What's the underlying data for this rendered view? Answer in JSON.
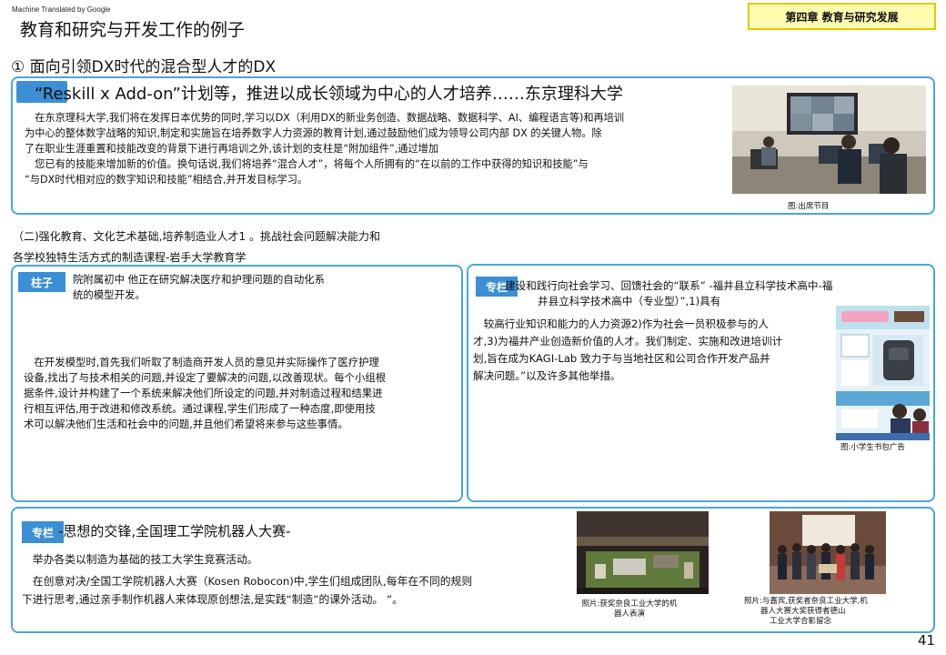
{
  "header": {
    "translation_note": "Machine Translated by Google",
    "title": "教育和研究与开发工作的例子",
    "chapter": "第四章 教育与研究发展"
  },
  "section1": {
    "title": "① 面向引领DX时代的混合型人才的DX",
    "card": {
      "heading": "“Reskill x Add-on”计划等，推进以成长领域为中心的人才培养……东京理科大学",
      "lines": [
        "　在东京理科大学,我们将在发挥日本优势的同时,学习以DX（利用DX的新业务创造、数据战略、数据科学、AI、编程语言等)和再培训",
        "为中心的整体数字战略的知识,制定和实施旨在培养数字人力资源的教育计划,通过鼓励他们成为领导公司内部 DX 的关键人物。除",
        "了在职业生涯重置和技能改变的背景下进行再培训之外,该计划的支柱是“附加组件”,通过增加",
        "　您已有的技能来增加新的价值。换句话说,我们将培养“混合人才”，将每个人所拥有的“在以前的工作中获得的知识和技能”与",
        "“与DX时代相对应的数字知识和技能”相结合,并开发目标学习。"
      ],
      "photo_caption": "图:出席节目"
    }
  },
  "section2": {
    "title_lines": [
      "（二)强化教育、文化艺术基础,培养制造业人才1 。挑战社会问题解决能力和",
      "各学校独特生活方式的制造课程-岩手大学教育学"
    ],
    "left_card": {
      "tag": "柱子",
      "intro_lines": [
        "院附属初中 他正在研究解决医疗和护理问题的自动化系",
        "统的模型开发。"
      ],
      "lines": [
        "　在开发模型时,首先我们听取了制造商开发人员的意见并实际操作了医疗护理",
        "设备,找出了与技术相关的问题,并设定了要解决的问题,以改善现状。每个小组根",
        "据条件,设计并构建了一个系统来解决他们所设定的问题,并对制造过程和结果进",
        "行相互评估,用于改进和修改系统。通过课程,学生们形成了一种态度,即使用技",
        "术可以解决他们生活和社会中的问题,并且他们希望将来参与这些事情。"
      ]
    },
    "right_card": {
      "tag": "专栏",
      "heading_lines": [
        "建设和践行向社会学习、回馈社会的“联系” -福井县立科学技术高中-福",
        "井县立科学技术高中（专业型）”,1)具有"
      ],
      "lines": [
        "　较高行业知识和能力的人力资源2)作为社会一员积极参与的人",
        "才,3)为福井产业创造新价值的人才。我们制定、实施和改进培训计",
        "划,旨在成为KAGI-Lab 致力于与当地社区和公司合作开发产品并",
        "解决问题。”以及许多其他举措。"
      ],
      "photo_caption": "图:小学生书包广告"
    }
  },
  "section3": {
    "tag": "专栏",
    "heading": "-思想的交锋,全国理工学院机器人大赛-",
    "lines": [
      "　举办各类以制造为基础的技工大学生竞赛活动。",
      "　在创意对决/全国工学院机器人大赛（Kosen Robocon)中,学生们组成团队,每年在不同的规则",
      "下进行思考,通过亲手制作机器人来体现原创想法,是实践“制造”的课外活动。 ”。"
    ],
    "photo1_caption_lines": [
      "照片:获奖奈良工业大学的机",
      "器人表演"
    ],
    "photo2_caption_lines": [
      "照片:与嘉宾,获奖者奈良工业大学,机",
      "器人大赛大奖获得者德山",
      "工业大学合影留念"
    ]
  },
  "footer": {
    "page_number": "41"
  },
  "colors": {
    "frame_border": "#4aa6dd",
    "tag_background": "#3b8fd4",
    "chapter_background": "#fffbb0",
    "chapter_border": "#e2c800"
  }
}
